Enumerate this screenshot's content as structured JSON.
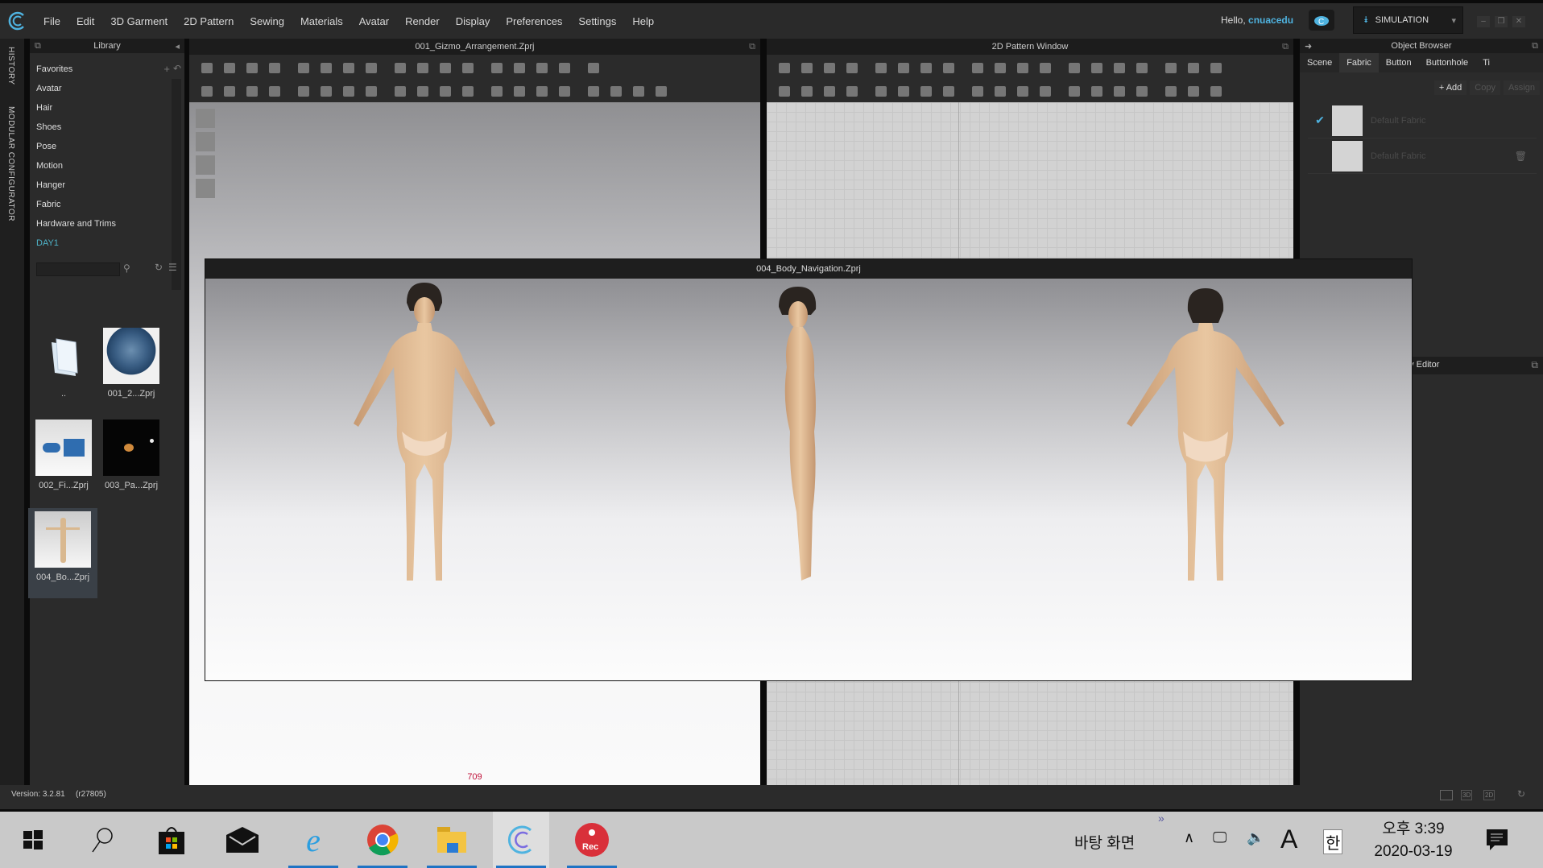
{
  "menu": [
    "File",
    "Edit",
    "3D Garment",
    "2D Pattern",
    "Sewing",
    "Materials",
    "Avatar",
    "Render",
    "Display",
    "Preferences",
    "Settings",
    "Help"
  ],
  "user": {
    "greeting": "Hello,",
    "name": "cnuacedu"
  },
  "mode": "SIMULATION",
  "side_tabs": [
    "HISTORY",
    "MODULAR CONFIGURATOR"
  ],
  "library": {
    "title": "Library",
    "categories": [
      "Favorites",
      "Avatar",
      "Hair",
      "Shoes",
      "Pose",
      "Motion",
      "Hanger",
      "Fabric",
      "Hardware and Trims",
      "DAY1"
    ],
    "search_placeholder": "",
    "files": [
      {
        "label": ".."
      },
      {
        "label": "001_2...Zprj"
      },
      {
        "label": "002_Fi...Zprj"
      },
      {
        "label": "003_Pa...Zprj"
      },
      {
        "label": "004_Bo...Zprj",
        "selected": true
      }
    ]
  },
  "window3d": {
    "title": "001_Gizmo_Arrangement.Zprj",
    "counter": "709"
  },
  "window2d": {
    "title": "2D Pattern Window"
  },
  "object_browser": {
    "title": "Object Browser",
    "tabs": [
      "Scene",
      "Fabric",
      "Button",
      "Buttonhole",
      "Ti"
    ],
    "selected_tab": "Fabric",
    "actions": [
      "+ Add",
      "Copy",
      "Assign"
    ],
    "fabrics": [
      {
        "name": "Default Fabric",
        "checked": true
      },
      {
        "name": "Default Fabric",
        "checked": false
      }
    ]
  },
  "property_editor": {
    "title": "Property Editor"
  },
  "overlay_window": {
    "title": "004_Body_Navigation.Zprj"
  },
  "status": {
    "version": "Version: 3.2.81",
    "revision": "(r27805)",
    "view_buttons": [
      "3D",
      "2D"
    ]
  },
  "taskbar": {
    "desktop_label": "바탕 화면",
    "ime_mode": "A",
    "ime_lang": "한",
    "time": "오후 3:39",
    "date": "2020-03-19"
  },
  "colors": {
    "accent": "#4fb3e0",
    "panel": "#2b2b2b",
    "counter": "#c0143c",
    "day1": "#4fb3c8"
  }
}
